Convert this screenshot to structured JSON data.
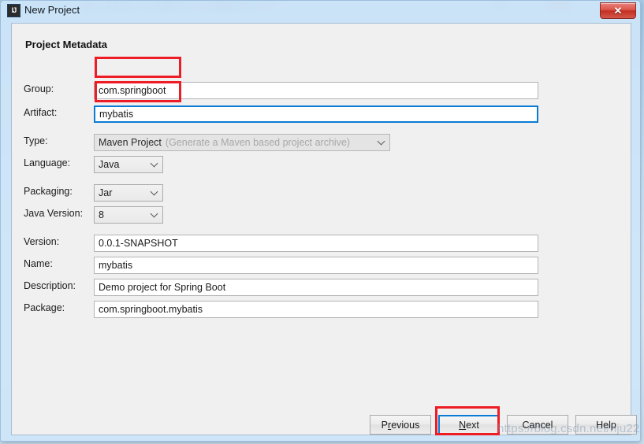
{
  "window": {
    "title": "New Project",
    "app_icon": "intellij-idea-icon",
    "icon_text": "IJ",
    "close_label": "✕"
  },
  "panel": {
    "section_title": "Project Metadata"
  },
  "form": {
    "fields": [
      {
        "label": "Group:",
        "value": "com.springboot",
        "kind": "text"
      },
      {
        "label": "Artifact:",
        "value": "mybatis",
        "kind": "text"
      },
      {
        "label": "Type:",
        "value": "Maven Project",
        "hint": "(Generate a Maven based project archive)",
        "kind": "combo"
      },
      {
        "label": "Language:",
        "value": "Java",
        "kind": "combo"
      },
      {
        "label": "Packaging:",
        "value": "Jar",
        "kind": "combo"
      },
      {
        "label": "Java Version:",
        "value": "8",
        "kind": "combo"
      },
      {
        "label": "Version:",
        "value": "0.0.1-SNAPSHOT",
        "kind": "text"
      },
      {
        "label": "Name:",
        "value": "mybatis",
        "kind": "text"
      },
      {
        "label": "Description:",
        "value": "Demo project for Spring Boot",
        "kind": "text"
      },
      {
        "label": "Package:",
        "value": "com.springboot.mybatis",
        "kind": "text"
      }
    ]
  },
  "buttons": {
    "previous": {
      "pre": "P",
      "mnemonic": "r",
      "post": "evious"
    },
    "next": {
      "pre": "",
      "mnemonic": "N",
      "post": "ext"
    },
    "cancel": {
      "label": "Cancel"
    },
    "help": {
      "label": "Help"
    }
  },
  "watermark": {
    "text": "https://blog.csdn.net/hju22"
  },
  "colors": {
    "annotation_red": "#ee1c25",
    "focus_blue": "#0a7bd4",
    "panel_bg": "#f0f0f0",
    "frame_blue": "#cde4f8",
    "close_red": "#c32f22"
  }
}
